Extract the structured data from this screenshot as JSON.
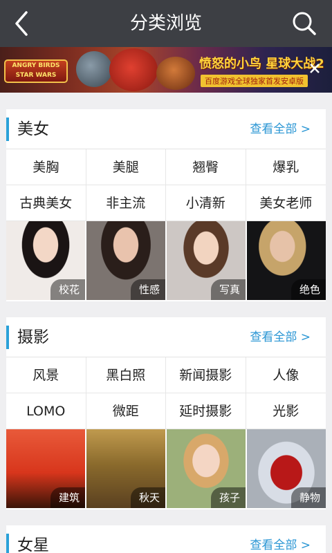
{
  "header": {
    "title": "分类浏览"
  },
  "banner": {
    "logo_line1": "ANGRY BIRDS",
    "logo_line2": "STAR WARS",
    "headline": "愤怒的小鸟 星球大战2",
    "subtitle": "百度游戏全球独家首发安卓版"
  },
  "sections": [
    {
      "title": "美女",
      "view_all": "查看全部 >",
      "tags": [
        "美胸",
        "美腿",
        "翘臀",
        "爆乳",
        "古典美女",
        "非主流",
        "小清新",
        "美女老师"
      ],
      "photos": [
        "校花",
        "性感",
        "写真",
        "绝色"
      ]
    },
    {
      "title": "摄影",
      "view_all": "查看全部 >",
      "tags": [
        "风景",
        "黑白照",
        "新闻摄影",
        "人像",
        "LOMO",
        "微距",
        "延时摄影",
        "光影"
      ],
      "photos": [
        "建筑",
        "秋天",
        "孩子",
        "静物"
      ]
    },
    {
      "title": "女星",
      "view_all": "查看全部 >"
    }
  ],
  "colors": {
    "accent": "#2aa1d8",
    "topbar": "#3d3f44",
    "background": "#efeff1"
  }
}
